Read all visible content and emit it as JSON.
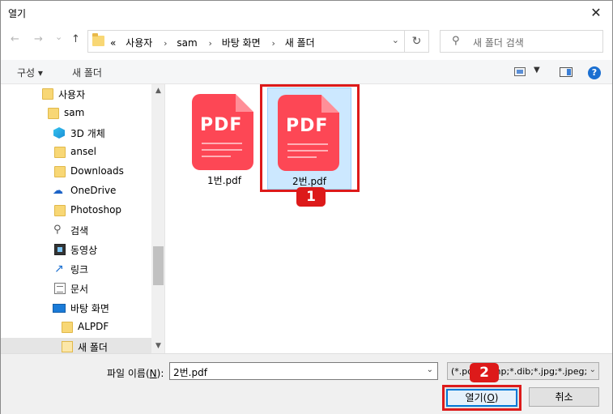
{
  "window": {
    "title": "열기",
    "close_glyph": "✕"
  },
  "nav": {
    "back_glyph": "←",
    "forward_glyph": "→",
    "recent_glyph": "⌄",
    "up_glyph": "↑",
    "breadcrumb_prefix": "«",
    "breadcrumbs": [
      "사용자",
      "sam",
      "바탕 화면",
      "새 폴더"
    ],
    "breadcrumb_sep": "›",
    "address_dropdown_glyph": "⌄",
    "refresh_glyph": "↻",
    "search_glyph": "⚲",
    "search_placeholder": "새 폴더 검색"
  },
  "toolbar": {
    "organize_label": "구성 ▾",
    "new_folder_label": "새 폴더",
    "view_dropdown_glyph": "▼",
    "help_glyph": "?"
  },
  "sidebar": {
    "items": [
      {
        "label": "사용자",
        "icon": "folder-icon"
      },
      {
        "label": "sam",
        "icon": "folder-icon"
      },
      {
        "label": "3D 개체",
        "icon": "3d-objects-icon"
      },
      {
        "label": "ansel",
        "icon": "folder-icon"
      },
      {
        "label": "Downloads",
        "icon": "folder-icon"
      },
      {
        "label": "OneDrive",
        "icon": "cloud-icon"
      },
      {
        "label": "Photoshop",
        "icon": "folder-icon"
      },
      {
        "label": "검색",
        "icon": "search-icon"
      },
      {
        "label": "동영상",
        "icon": "video-icon"
      },
      {
        "label": "링크",
        "icon": "link-icon"
      },
      {
        "label": "문서",
        "icon": "document-icon"
      },
      {
        "label": "바탕 화면",
        "icon": "desktop-icon"
      },
      {
        "label": "ALPDF",
        "icon": "folder-icon"
      },
      {
        "label": "새 폴더",
        "icon": "folder-icon",
        "selected": true
      }
    ],
    "scroll_up_glyph": "▲",
    "scroll_down_glyph": "▼"
  },
  "files": [
    {
      "name": "1번.pdf",
      "icon_text": "PDF",
      "selected": false
    },
    {
      "name": "2번.pdf",
      "icon_text": "PDF",
      "selected": true
    }
  ],
  "annotations": {
    "badge1": "1",
    "badge2": "2",
    "accent": "#dd1a1a"
  },
  "bottom": {
    "filename_label_prefix": "파일 이름(",
    "filename_label_key": "N",
    "filename_label_suffix": "):",
    "filename_value": "2번.pdf",
    "filename_dropdown_glyph": "⌄",
    "filetype_value": "(*.pdf;*.bmp;*.dib;*.jpg;*.jpeg;*",
    "filetype_dropdown_glyph": "⌄",
    "open_label_prefix": "열기(",
    "open_label_key": "O",
    "open_label_suffix": ")",
    "cancel_label": "취소"
  }
}
